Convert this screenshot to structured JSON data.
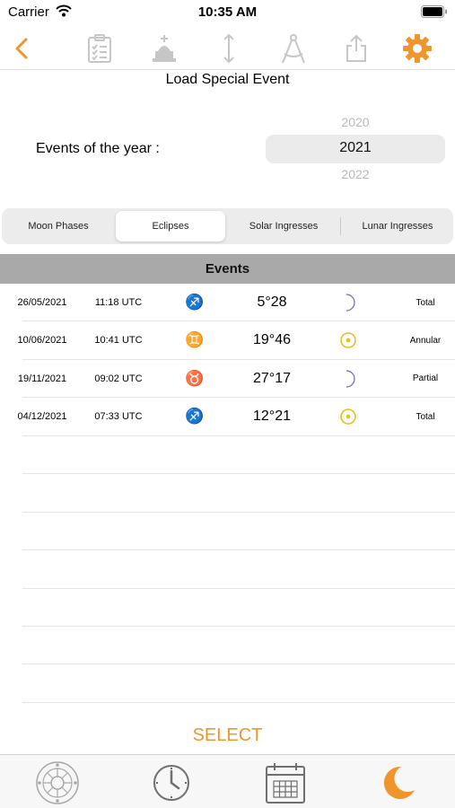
{
  "status_bar": {
    "carrier": "Carrier",
    "time": "10:35 AM"
  },
  "toolbar": {
    "icons": [
      "back-chevron-icon",
      "checklist-icon",
      "monument-icon",
      "vertical-arrows-icon",
      "compass-icon",
      "share-icon",
      "gear-icon"
    ],
    "accent_color": "#f0952b"
  },
  "page": {
    "title": "Load Special Event"
  },
  "year_picker": {
    "label": "Events of the year :",
    "prev": "2020",
    "selected": "2021",
    "next": "2022"
  },
  "tabs": [
    {
      "label": "Moon Phases",
      "active": false
    },
    {
      "label": "Eclipses",
      "active": true
    },
    {
      "label": "Solar Ingresses",
      "active": false
    },
    {
      "label": "Lunar Ingresses",
      "active": false
    }
  ],
  "events": {
    "header": "Events",
    "rows": [
      {
        "date": "26/05/2021",
        "time": "11:18 UTC",
        "sign": "♐",
        "sign_color": "#d8262c",
        "degree": "5°28",
        "body": "moon",
        "type": "Total"
      },
      {
        "date": "10/06/2021",
        "time": "10:41 UTC",
        "sign": "♊",
        "sign_color": "#3fae2a",
        "degree": "19°46",
        "body": "sun",
        "type": "Annular"
      },
      {
        "date": "19/11/2021",
        "time": "09:02 UTC",
        "sign": "♉",
        "sign_color": "#d88a14",
        "degree": "27°17",
        "body": "moon",
        "type": "Partial"
      },
      {
        "date": "04/12/2021",
        "time": "07:33 UTC",
        "sign": "♐",
        "sign_color": "#d8262c",
        "degree": "12°21",
        "body": "sun",
        "type": "Total"
      }
    ]
  },
  "actions": {
    "select_label": "SELECT"
  },
  "tab_bar": {
    "icons": [
      "zodiac-wheel-icon",
      "clock-icon",
      "calendar-icon",
      "crescent-moon-icon"
    ]
  }
}
